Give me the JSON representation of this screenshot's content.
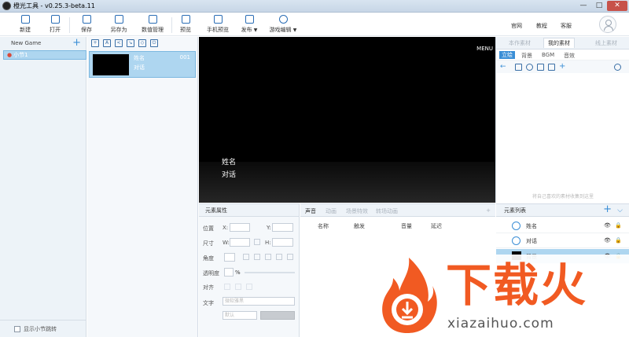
{
  "window": {
    "title": "橙光工具 - v0.25.3-beta.11",
    "min": "—",
    "max": "□",
    "close": "✕"
  },
  "toolbar": {
    "new": "新建",
    "open": "打开",
    "save": "保存",
    "save_as": "另存为",
    "data_manage": "数值管理",
    "preview": "预览",
    "mobile_preview": "手机预览",
    "publish": "发布",
    "game_edit": "游戏编辑",
    "links": {
      "official": "官网",
      "tutorial": "教程",
      "service": "客服"
    }
  },
  "chapters": {
    "title": "New Game",
    "add": "+",
    "items": [
      {
        "label": "小节1"
      }
    ],
    "footer_label": "显示小节跳转"
  },
  "scenes": {
    "items": [
      {
        "name": "姓名",
        "text": "对话",
        "number": "001"
      }
    ]
  },
  "stage": {
    "menu": "MENU",
    "speaker": "姓名",
    "dialogue": "对话"
  },
  "materials": {
    "tabs": [
      "本作素材",
      "我的素材",
      "线上素材"
    ],
    "active_tab": "我的素材",
    "categories": [
      "立绘",
      "背景",
      "BGM",
      "音效"
    ],
    "active_category": "立绘",
    "hint": "将自己喜欢的素材收集到这里"
  },
  "properties": {
    "title": "元素属性",
    "position": "位置",
    "x": "X:",
    "y": "Y:",
    "size": "尺寸",
    "w": "W:",
    "h": "H:",
    "angle": "角度",
    "opacity": "透明度",
    "opacity_unit": "%",
    "align": "对齐",
    "text": "文字",
    "font_placeholder": "微软雅黑",
    "size_placeholder": "默认"
  },
  "sound": {
    "tabs": [
      "声音",
      "动画",
      "场景特效",
      "转场动画"
    ],
    "active_tab": "声音",
    "columns": [
      "名称",
      "触发",
      "音量",
      "延迟"
    ],
    "add": "+"
  },
  "elements": {
    "title": "元素列表",
    "add": "+",
    "collapse": "⌵",
    "items": [
      {
        "label": "姓名"
      },
      {
        "label": "对话"
      },
      {
        "label": "背景"
      }
    ],
    "eye": "👁",
    "lock": "🔒"
  },
  "watermark": {
    "brand": "下载火",
    "domain": "xiazaihuo.com"
  },
  "colors": {
    "accent": "#3a8ed6",
    "selection": "#aed6f0",
    "brand": "#f15a22"
  }
}
